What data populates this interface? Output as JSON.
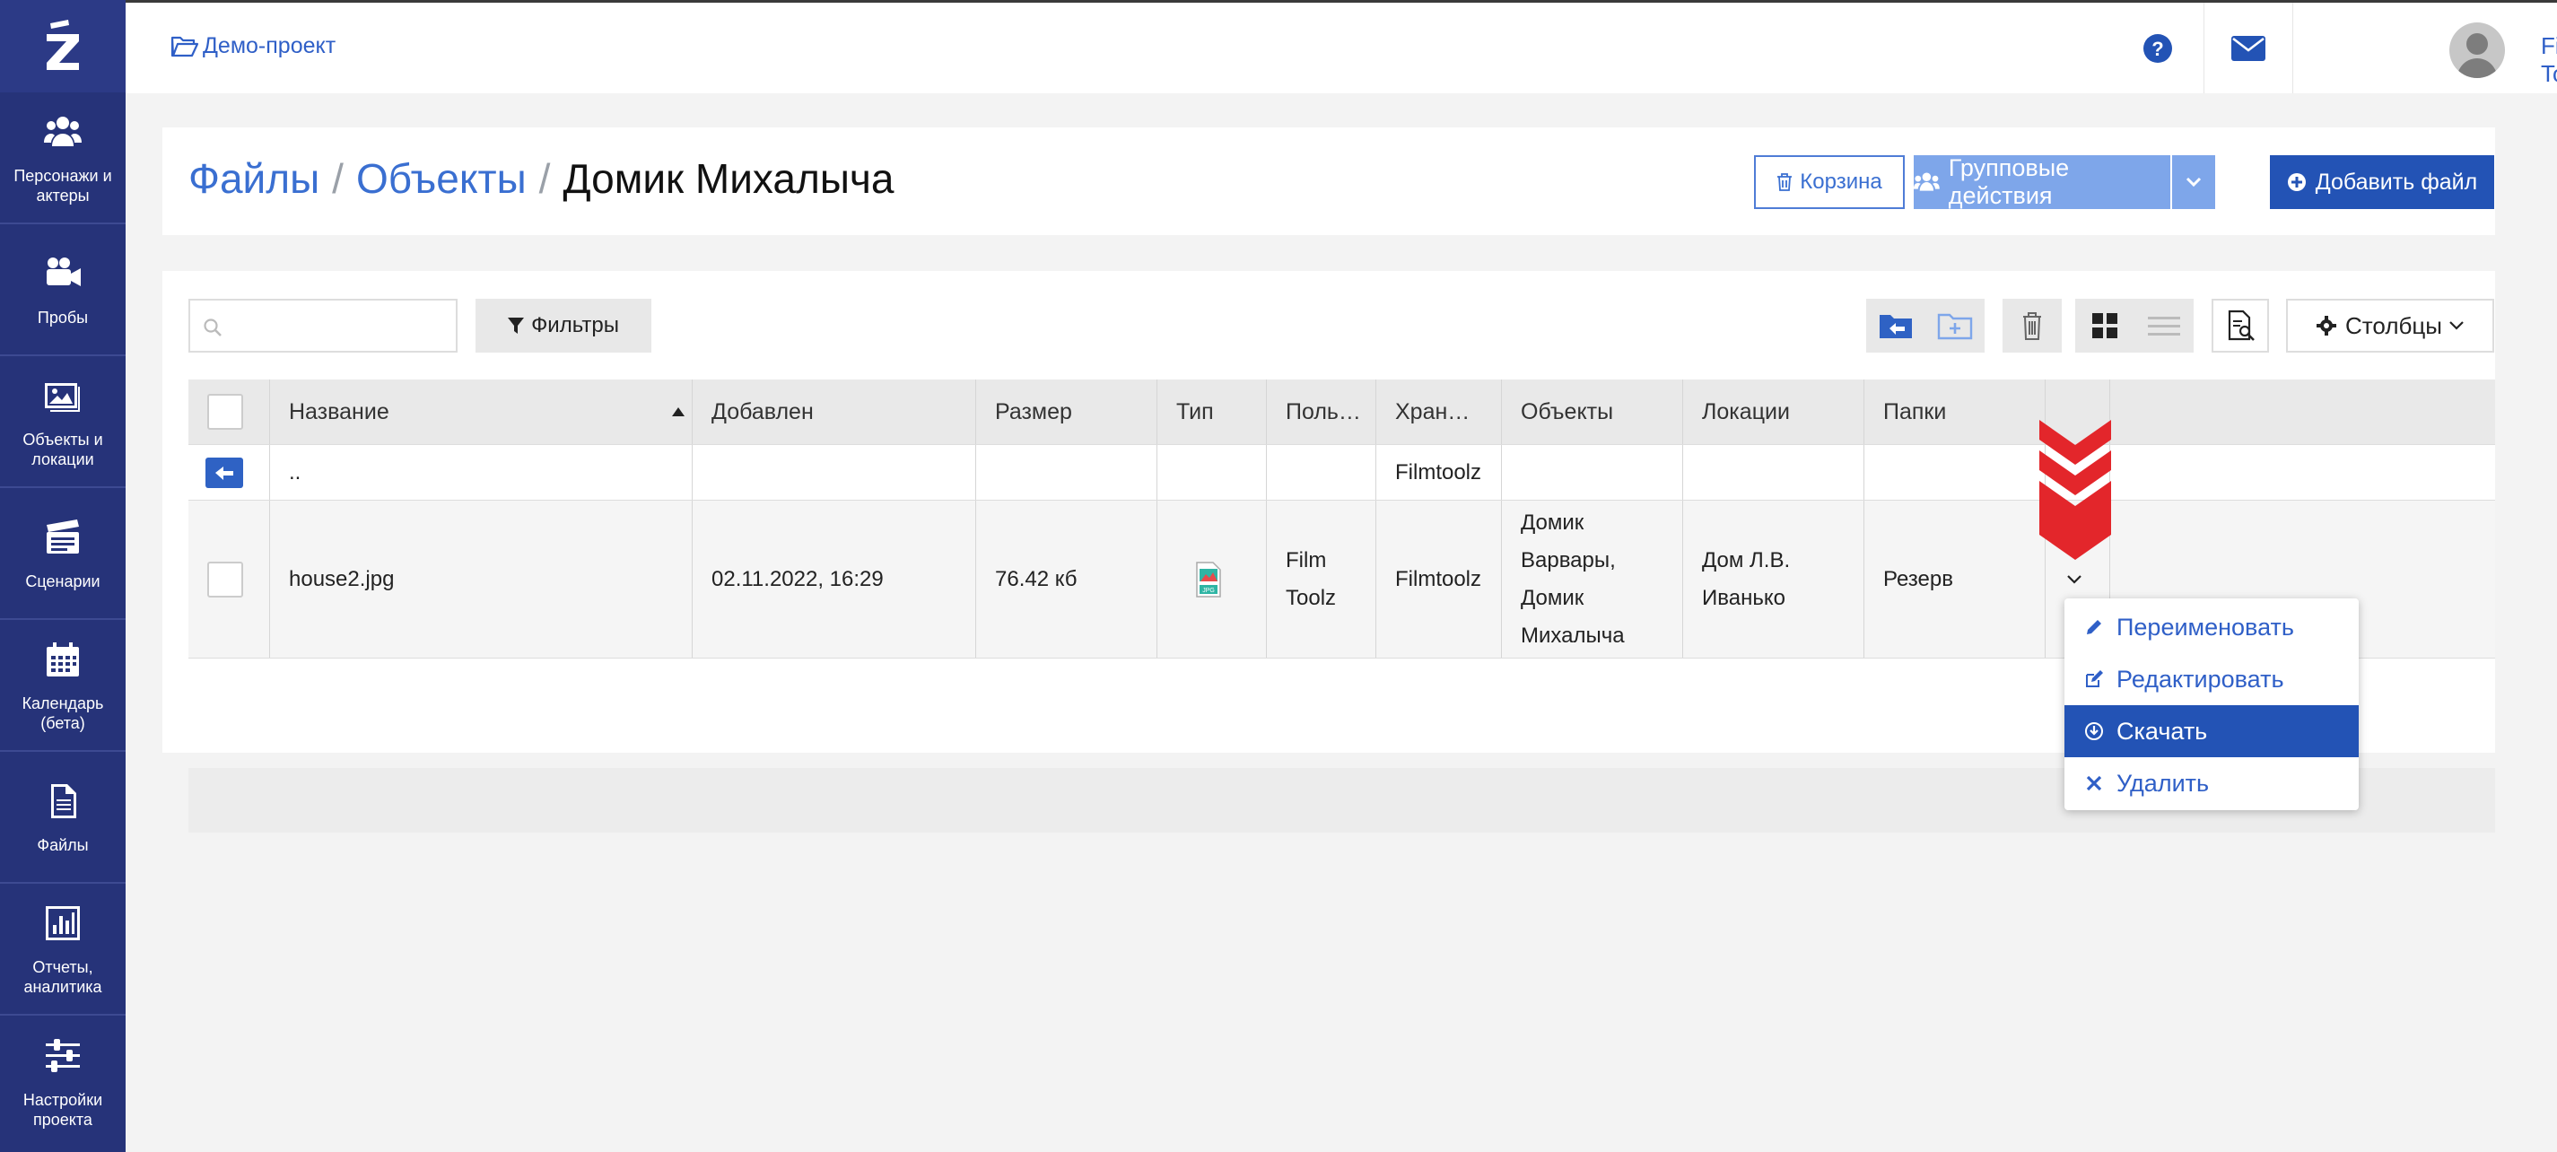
{
  "sidebar": {
    "items": [
      {
        "label": "Персонажи и актеры",
        "icon": "people-icon"
      },
      {
        "label": "Пробы",
        "icon": "video-camera-icon"
      },
      {
        "label": "Объекты и локации",
        "icon": "image-icon"
      },
      {
        "label": "Сценарии",
        "icon": "clapperboard-icon"
      },
      {
        "label": "Календарь (бета)",
        "icon": "calendar-icon"
      },
      {
        "label": "Файлы",
        "icon": "file-icon"
      },
      {
        "label": "Отчеты, аналитика",
        "icon": "chart-icon"
      },
      {
        "label": "Настройки проекта",
        "icon": "sliders-icon"
      }
    ]
  },
  "topbar": {
    "project": "Демо-проект",
    "user_name": "Film Toolz"
  },
  "header": {
    "crumb_files": "Файлы",
    "crumb_objects": "Объекты",
    "sep": "/",
    "crumb_current": "Домик Михалыча",
    "trash_label": "Корзина",
    "group_actions_label": "Групповые действия",
    "add_file_label": "Добавить файл"
  },
  "toolbar": {
    "search_placeholder": "",
    "filters_label": "Фильтры",
    "columns_label": "Столбцы"
  },
  "table": {
    "columns": [
      "Название",
      "Добавлен",
      "Размер",
      "Тип",
      "Поль…",
      "Хран…",
      "Объекты",
      "Локации",
      "Папки"
    ],
    "parent_row": {
      "name": "..",
      "storage": "Filmtoolz"
    },
    "rows": [
      {
        "name": "house2.jpg",
        "added": "02.11.2022, 16:29",
        "size": "76.42 кб",
        "type_badge": "JPG",
        "user_line1": "Film",
        "user_line2": "Toolz",
        "storage": "Filmtoolz",
        "objects_l1": "Домик",
        "objects_l2": "Варвары,",
        "objects_l3": "Домик",
        "objects_l4": "Михалыча",
        "locations_l1": "Дом Л.В.",
        "locations_l2": "Иванько",
        "folder": "Резерв"
      }
    ]
  },
  "menu": {
    "rename": "Переименовать",
    "edit": "Редактировать",
    "download": "Скачать",
    "delete": "Удалить"
  },
  "colors": {
    "sidebar": "#263379",
    "primary": "#2353b5",
    "link": "#3a6fd1",
    "arrow_red": "#e3262b"
  }
}
